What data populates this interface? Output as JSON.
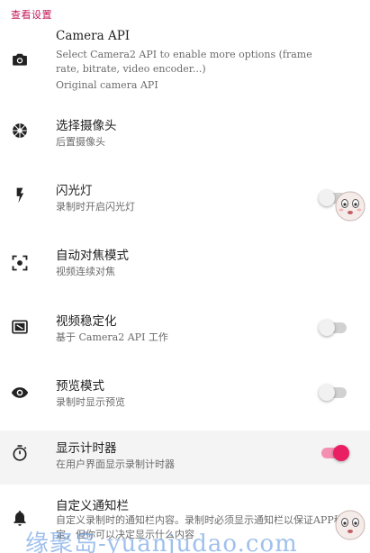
{
  "header": {
    "title": "查看设置"
  },
  "settings": [
    {
      "icon": "camera-icon",
      "title": "Camera API",
      "subtitle": "Select Camera2 API to enable more options (frame rate, bitrate, video encoder...)",
      "value": "Original camera API"
    },
    {
      "icon": "camera-switch-icon",
      "title": "选择摄像头",
      "subtitle": "后置摄像头"
    },
    {
      "icon": "flash-icon",
      "title": "闪光灯",
      "subtitle": "录制时开启闪光灯",
      "toggle": false
    },
    {
      "icon": "focus-icon",
      "title": "自动对焦模式",
      "subtitle": "视频连续对焦"
    },
    {
      "icon": "stabilization-icon",
      "title": "视频稳定化",
      "subtitle": "基于 Camera2 API 工作",
      "toggle": false
    },
    {
      "icon": "eye-icon",
      "title": "预览模式",
      "subtitle": "录制时显示预览",
      "toggle": false
    },
    {
      "icon": "timer-icon",
      "title": "显示计时器",
      "subtitle": "在用户界面显示录制计时器",
      "toggle": true
    },
    {
      "icon": "bell-icon",
      "title": "自定义通知栏",
      "subtitle": "自定义录制时的通知栏内容。录制时必须显示通知栏以保证APP稳定，但你可以决定显示什么内容"
    }
  ],
  "watermark": {
    "text": "缘聚岛-yuanjudao.com"
  },
  "colors": {
    "accent": "#e91e63",
    "header": "#c2185b"
  }
}
